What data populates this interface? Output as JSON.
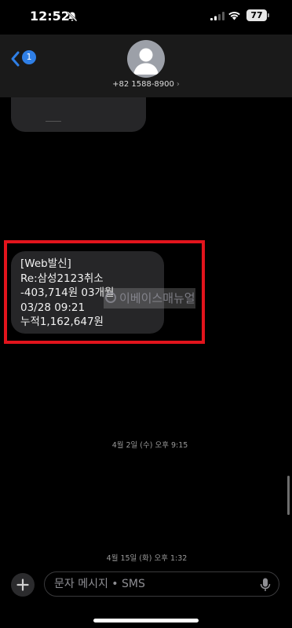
{
  "status": {
    "time": "12:52",
    "battery": "77"
  },
  "header": {
    "unread_count": "1",
    "contact_number": "+82 1588-8900"
  },
  "message": {
    "lines": [
      "[Web발신]",
      "Re:삼성2123취소",
      "-403,714원 03개월",
      "03/28 09:21",
      "누적1,162,647원"
    ]
  },
  "watermark": "이베이스매뉴얼",
  "timestamps": {
    "first": "4월 2일 (수) 오후 9:15",
    "second": "4월 15일 (화) 오후 1:32"
  },
  "compose": {
    "placeholder": "문자 메시지 • SMS"
  },
  "colors": {
    "accent": "#2f7fe6",
    "highlight_box": "#e2141c",
    "bubble": "#262628"
  }
}
